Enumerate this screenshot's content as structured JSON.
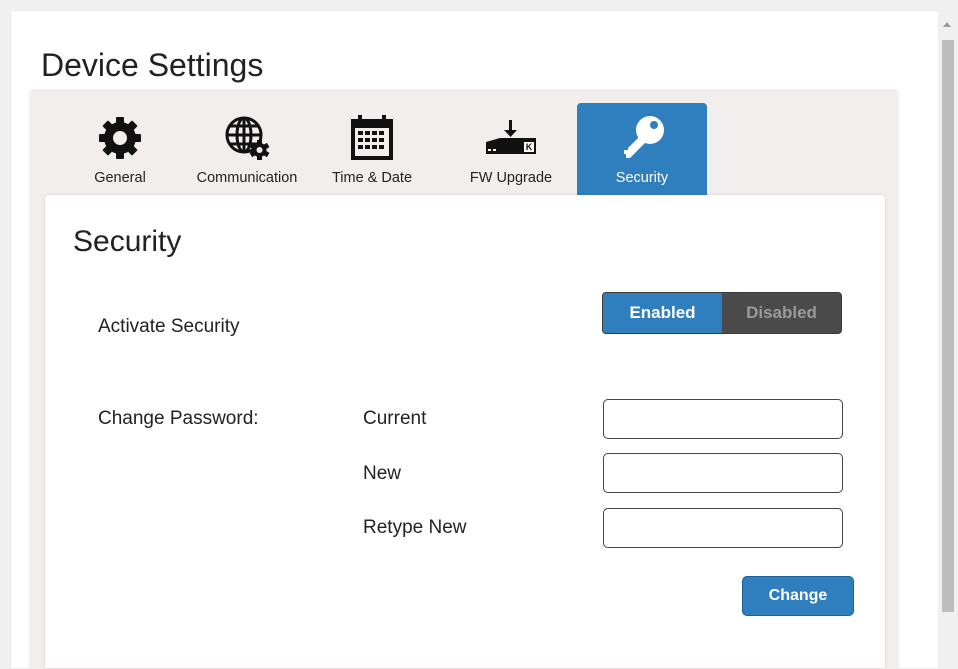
{
  "page": {
    "title": "Device Settings"
  },
  "tabs": [
    {
      "label": "General",
      "icon": "gear-icon"
    },
    {
      "label": "Communication",
      "icon": "globe-gear-icon"
    },
    {
      "label": "Time & Date",
      "icon": "calendar-icon"
    },
    {
      "label": "FW Upgrade",
      "icon": "firmware-download-icon"
    },
    {
      "label": "Security",
      "icon": "key-icon",
      "active": true
    }
  ],
  "panel": {
    "title": "Security",
    "activate_label": "Activate Security",
    "toggle": {
      "enabled_label": "Enabled",
      "disabled_label": "Disabled",
      "selected": "Enabled"
    },
    "change_password_label": "Change Password:",
    "fields": [
      {
        "label": "Current",
        "value": ""
      },
      {
        "label": "New",
        "value": ""
      },
      {
        "label": "Retype New",
        "value": ""
      }
    ],
    "change_button": "Change"
  },
  "colors": {
    "accent": "#2f7fbf",
    "toggle_off_bg": "#4a4a4a",
    "tab_strip_bg": "#f2eeee"
  }
}
